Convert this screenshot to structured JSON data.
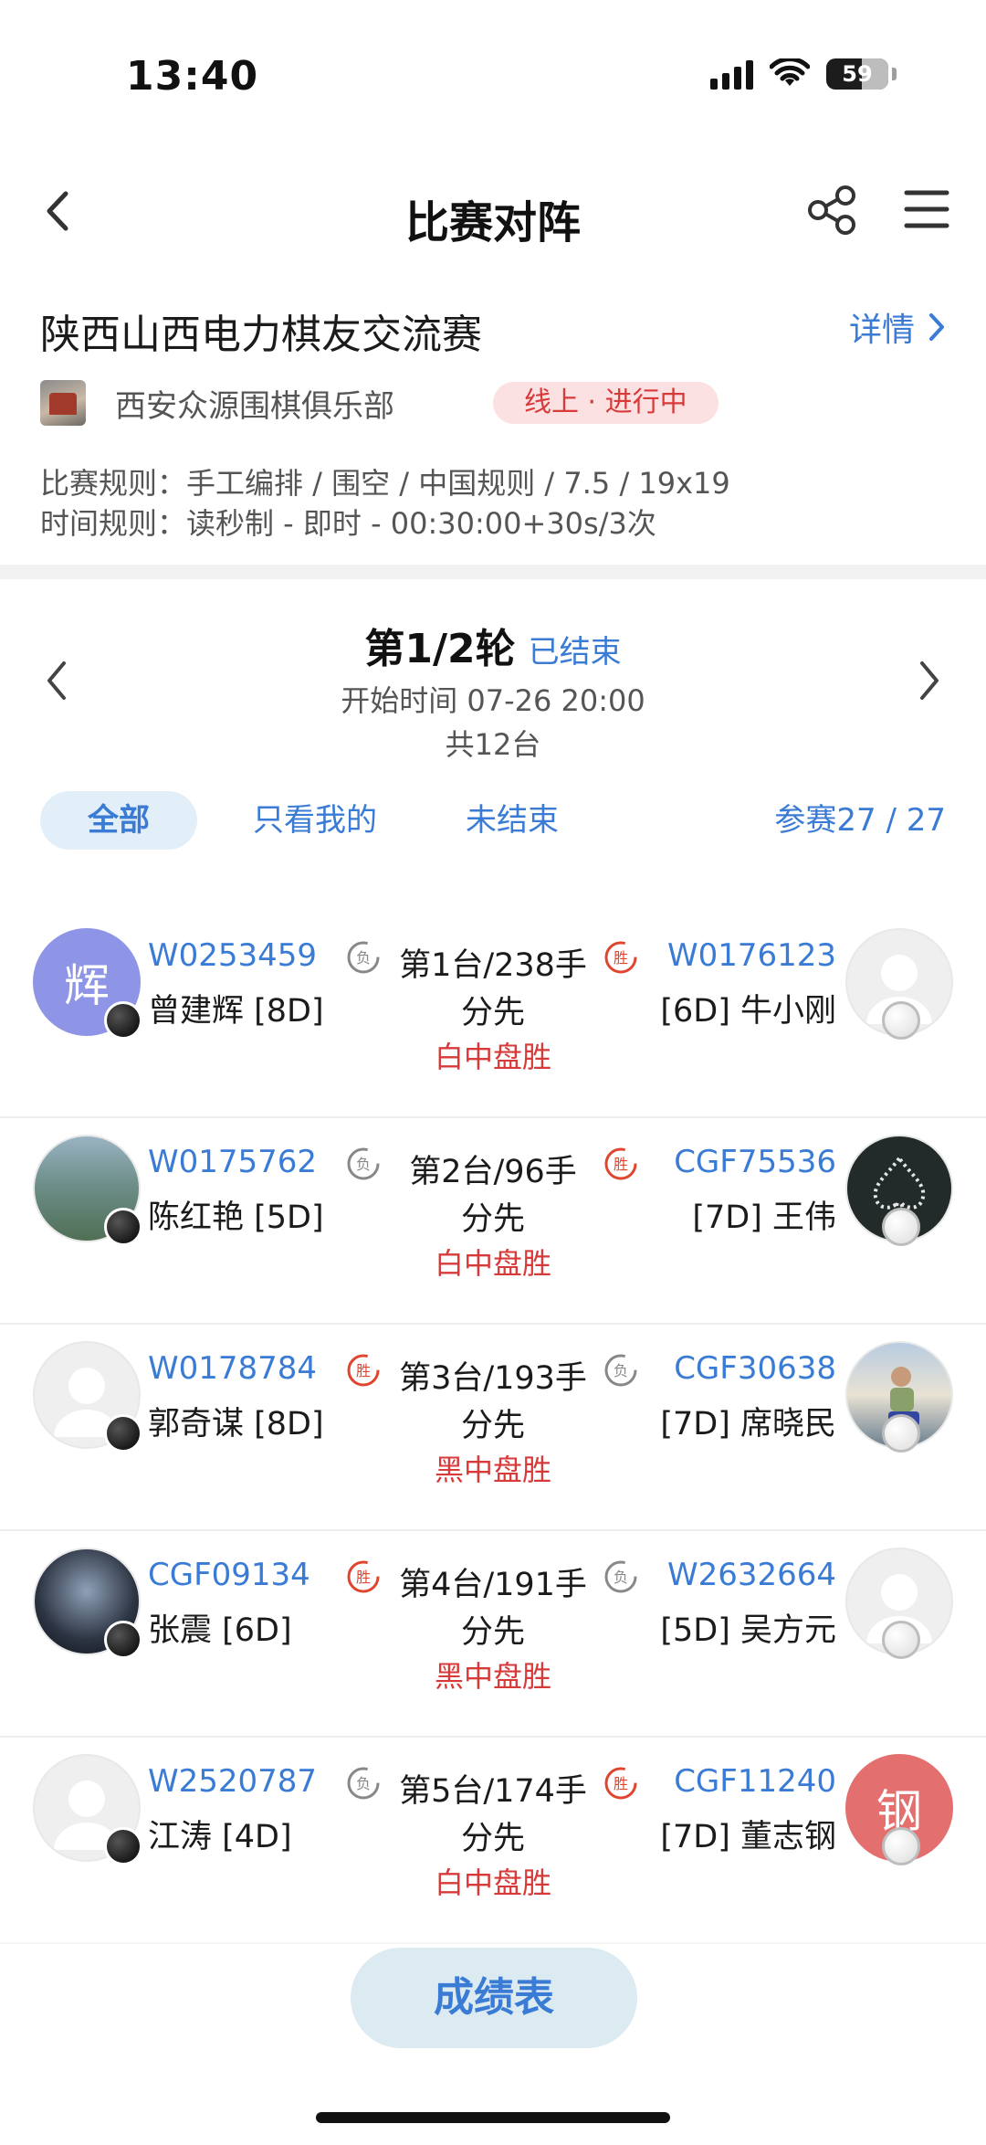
{
  "status_bar": {
    "time": "13:40",
    "battery": "59"
  },
  "nav": {
    "title": "比赛对阵"
  },
  "match": {
    "title": "陕西山西电力棋友交流赛",
    "detail_label": "详情",
    "club_name": "西安众源围棋俱乐部",
    "status": "线上 · 进行中",
    "rules": "比赛规则：手工编排 / 围空 / 中国规则 / 7.5 / 19x19",
    "time_rules": "时间规则：读秒制 - 即时 - 00:30:00+30s/3次"
  },
  "round": {
    "title": "第1/2轮",
    "state": "已结束",
    "start_time": "开始时间 07-26 20:00",
    "boards": "共12台"
  },
  "filters": {
    "all": "全部",
    "mine": "只看我的",
    "unfinished": "未结束",
    "participants": "参赛27 / 27"
  },
  "pairings": [
    {
      "left": {
        "uid": "W0253459",
        "name": "曾建辉 [8D]",
        "avatar_letter": "辉",
        "avatar_color": "#8e94e6",
        "result_icon": "loss"
      },
      "board": "第1台/238手",
      "handicap": "分先",
      "result": "白中盘胜",
      "right": {
        "uid": "W0176123",
        "name": "[6D] 牛小刚",
        "avatar_letter": "",
        "avatar_color": "",
        "result_icon": "win"
      }
    },
    {
      "left": {
        "uid": "W0175762",
        "name": "陈红艳 [5D]",
        "avatar_letter": "",
        "avatar_color": "#6e8f8a",
        "result_icon": "loss"
      },
      "board": "第2台/96手",
      "handicap": "分先",
      "result": "白中盘胜",
      "right": {
        "uid": "CGF75536",
        "name": "[7D] 王伟",
        "avatar_letter": "",
        "avatar_color": "#222a2a",
        "result_icon": "win"
      }
    },
    {
      "left": {
        "uid": "W0178784",
        "name": "郭奇谋 [8D]",
        "avatar_letter": "",
        "avatar_color": "",
        "result_icon": "win"
      },
      "board": "第3台/193手",
      "handicap": "分先",
      "result": "黑中盘胜",
      "right": {
        "uid": "CGF30638",
        "name": "[7D] 席晓民",
        "avatar_letter": "",
        "avatar_color": "#9fb3c4",
        "result_icon": "loss"
      }
    },
    {
      "left": {
        "uid": "CGF09134",
        "name": "张震 [6D]",
        "avatar_letter": "",
        "avatar_color": "#2c3442",
        "result_icon": "win"
      },
      "board": "第4台/191手",
      "handicap": "分先",
      "result": "黑中盘胜",
      "right": {
        "uid": "W2632664",
        "name": "[5D] 吴方元",
        "avatar_letter": "",
        "avatar_color": "",
        "result_icon": "loss"
      }
    },
    {
      "left": {
        "uid": "W2520787",
        "name": "江涛 [4D]",
        "avatar_letter": "",
        "avatar_color": "",
        "result_icon": "loss"
      },
      "board": "第5台/174手",
      "handicap": "分先",
      "result": "白中盘胜",
      "right": {
        "uid": "CGF11240",
        "name": "[7D] 董志钢",
        "avatar_letter": "钢",
        "avatar_color": "#e36f6f",
        "result_icon": "win"
      }
    }
  ],
  "bottom": {
    "score_button": "成绩表"
  },
  "colors": {
    "accent": "#3a7bd5",
    "red": "#d83a3a",
    "pill_bg": "#fbe1e1"
  }
}
